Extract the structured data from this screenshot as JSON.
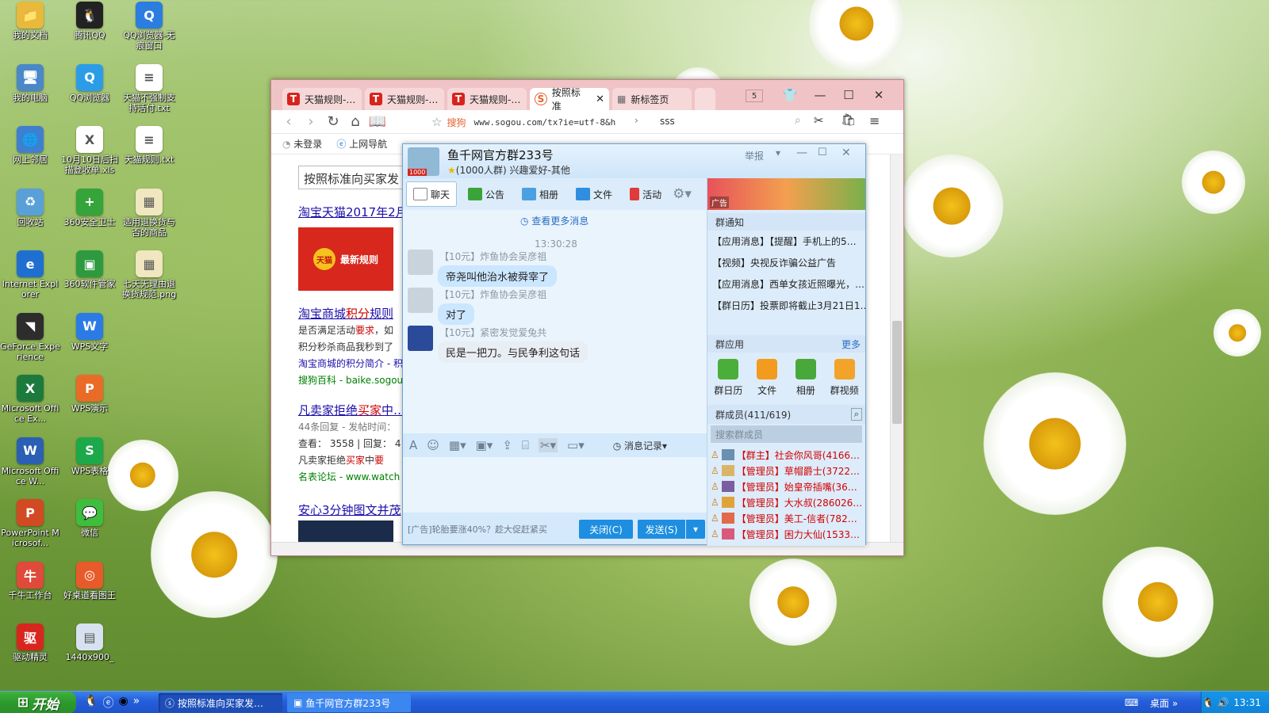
{
  "desktop": {
    "icons": [
      {
        "label": "我的文档",
        "color": "#e8b93a",
        "glyph": "📁"
      },
      {
        "label": "腾讯QQ",
        "color": "#222222",
        "glyph": "🐧"
      },
      {
        "label": "QQ浏览器-无痕窗口",
        "color": "#2b7de0",
        "glyph": "Q"
      },
      {
        "label": "我的电脑",
        "color": "#4a88c7",
        "glyph": "🖥"
      },
      {
        "label": "QQ浏览器",
        "color": "#2b9de8",
        "glyph": "Q"
      },
      {
        "label": "天猫不强制支持活付.txt",
        "color": "#ffffff",
        "glyph": "≡"
      },
      {
        "label": "网上邻居",
        "color": "#3f7fd0",
        "glyph": "🌐"
      },
      {
        "label": "10月10日后扫描登收单.xls",
        "color": "#ffffff",
        "glyph": "X"
      },
      {
        "label": "天猫规则.txt",
        "color": "#ffffff",
        "glyph": "≡"
      },
      {
        "label": "回收站",
        "color": "#5aa0d8",
        "glyph": "♻"
      },
      {
        "label": "360安全卫士",
        "color": "#35a43a",
        "glyph": "+"
      },
      {
        "label": "适用退换货与否的商品",
        "color": "#f0e6c0",
        "glyph": "▦"
      },
      {
        "label": "Internet Explorer",
        "color": "#1f6fd1",
        "glyph": "e"
      },
      {
        "label": "360软件管家",
        "color": "#2e9a3f",
        "glyph": "▣"
      },
      {
        "label": "七天无理由退换货规范.png",
        "color": "#f0e6c0",
        "glyph": "▦"
      },
      {
        "label": "GeForce Experience",
        "color": "#2d2d2d",
        "glyph": "◥"
      },
      {
        "label": "WPS文字",
        "color": "#2a7be6",
        "glyph": "W"
      },
      {
        "label": "Microsoft Office Ex...",
        "color": "#1d7a3d",
        "glyph": "X"
      },
      {
        "label": "WPS演示",
        "color": "#ea6b28",
        "glyph": "P"
      },
      {
        "label": "Microsoft Office W...",
        "color": "#2b5fb3",
        "glyph": "W"
      },
      {
        "label": "WPS表格",
        "color": "#1da84a",
        "glyph": "S"
      },
      {
        "label": "PowerPoint Microsof...",
        "color": "#d14a24",
        "glyph": "P"
      },
      {
        "label": "微信",
        "color": "#3ebd3e",
        "glyph": "💬"
      },
      {
        "label": "千牛工作台",
        "color": "#e04a3a",
        "glyph": "牛"
      },
      {
        "label": "好桌道看图王",
        "color": "#e75b2a",
        "glyph": "◎"
      },
      {
        "label": "驱动精灵",
        "color": "#d8261e",
        "glyph": "驱"
      },
      {
        "label": "1440x900_",
        "color": "#d8e1ef",
        "glyph": "▤"
      }
    ]
  },
  "browser": {
    "tabs": [
      {
        "label": "天猫规则-…",
        "icon": "tmall-icon"
      },
      {
        "label": "天猫规则-…",
        "icon": "tmall-icon"
      },
      {
        "label": "天猫规则-…",
        "icon": "tmall-icon"
      },
      {
        "label": "按照标准",
        "icon": "sogou-icon"
      },
      {
        "label": "新标签页",
        "icon": "grid-icon"
      }
    ],
    "tab_count": "5",
    "search_engine": "搜狗",
    "url": "www.sogou.com/tx?ie=utf-8&h",
    "search_text": "sss",
    "bookmarks": [
      "未登录",
      "上网导航"
    ],
    "query": "按照标准向买家发",
    "results": [
      {
        "title": "淘宝天猫2017年2月",
        "banner_text": "最新规则",
        "banner_logo": "天猫"
      },
      {
        "title_pre": "淘宝商城",
        "title_red": "积分",
        "title_post": "规则",
        "desc1_pre": "是否满足活动",
        "desc1_red": "要求",
        "desc1_post": "，如",
        "desc2": "积分秒杀商品我秒到了",
        "sub": "淘宝商城的积分简介 - 积",
        "source": "搜狗百科 - baike.sogou"
      },
      {
        "title_pre": "凡卖家拒绝",
        "title_red": "买家",
        "title_post": "中…",
        "meta": "44条回复 - 发帖时间：",
        "stats": "查看： 3558 | 回复： 4",
        "desc_pre": "凡卖家拒绝",
        "desc_red": "买家",
        "desc_mid": "中",
        "desc_red2": "要",
        "source": "名表论坛 - www.watch"
      },
      {
        "title": "安心3分钟图文并茂"
      }
    ]
  },
  "qq": {
    "title": "鱼千网官方群233号",
    "subtitle": "(1000人群) 兴趣爱好-其他",
    "badge": "1000",
    "report": "举报",
    "tools": [
      "聊天",
      "公告",
      "相册",
      "文件",
      "活动"
    ],
    "ad_label": "广告",
    "load_more": "查看更多消息",
    "time": "13:30:28",
    "messages": [
      {
        "name": "【10元】炸鱼协会吴彦祖",
        "text": "帝尧叫他治水被舜宰了"
      },
      {
        "name": "【10元】炸鱼协会吴彦祖",
        "text": "对了"
      },
      {
        "name": "【10元】紧密发觉爱兔共",
        "text": "民是一把刀。与民争利这句话"
      }
    ],
    "history": "消息记录",
    "ad_text": "[广告]轮胎要涨40%？趁大促赶紧买",
    "close_btn": "关闭(C)",
    "send_btn": "发送(S)",
    "notice_header": "群通知",
    "notices": [
      "【应用消息】【提醒】手机上的5…",
      "【视频】央视反诈骗公益广告",
      "【应用消息】西单女孩近照曝光，…",
      "【群日历】投票即将截止3月21日1…"
    ],
    "apps_header": "群应用",
    "apps_more": "更多",
    "apps": [
      {
        "label": "群日历",
        "color": "#4cae3a"
      },
      {
        "label": "文件",
        "color": "#f39b1e"
      },
      {
        "label": "相册",
        "color": "#49a83c"
      },
      {
        "label": "群视频",
        "color": "#f2a32a"
      }
    ],
    "members_header": "群成员(411/619)",
    "member_search": "搜索群成员",
    "members": [
      {
        "role": "【群主】",
        "name": "社会你风哥(4166…"
      },
      {
        "role": "【管理员】",
        "name": "草帽爵士(3722…"
      },
      {
        "role": "【管理员】",
        "name": "始皇帝插嘴(36…"
      },
      {
        "role": "【管理员】",
        "name": "大水叔(286026…"
      },
      {
        "role": "【管理员】",
        "name": "美工-信者(782…"
      },
      {
        "role": "【管理员】",
        "name": "困力大仙(1533…"
      }
    ]
  },
  "taskbar": {
    "start": "开始",
    "tasks": [
      "按照标准向买家发…",
      "鱼千网官方群233号"
    ],
    "desktop_label": "桌面",
    "clock": "13:31"
  }
}
